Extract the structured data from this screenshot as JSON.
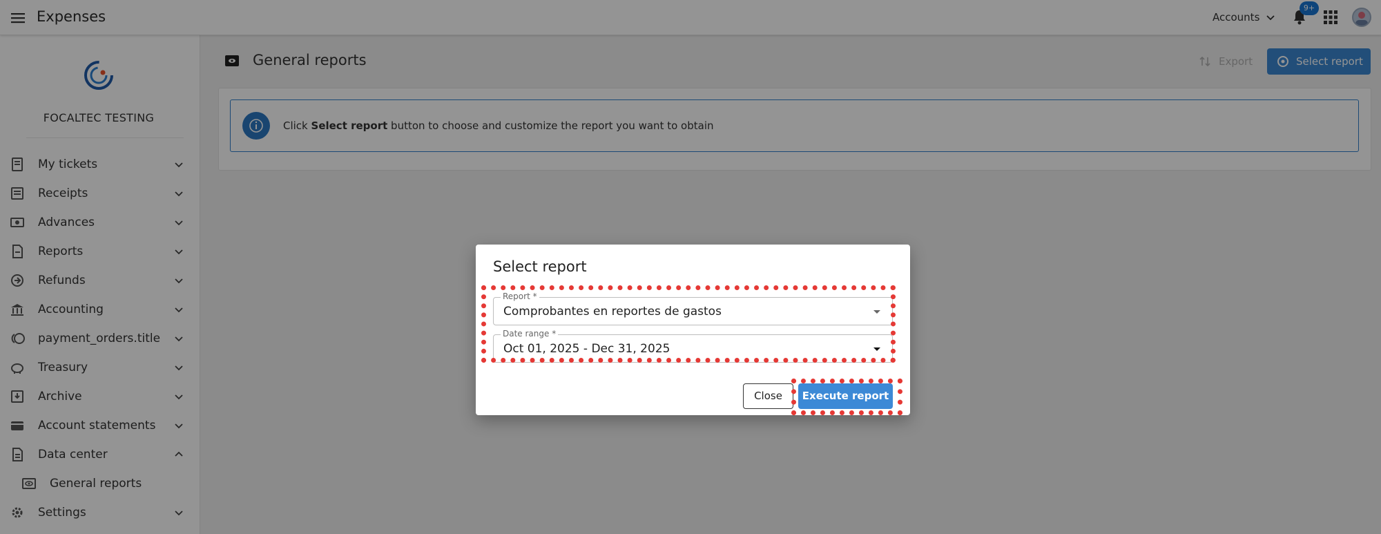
{
  "app": {
    "title": "Expenses",
    "accounts_label": "Accounts",
    "notification_badge": "9+"
  },
  "org_name": "FOCALTEC TESTING",
  "sidebar": {
    "items": [
      {
        "label": "My tickets",
        "icon": "ticket-icon",
        "expanded": false
      },
      {
        "label": "Receipts",
        "icon": "receipt-icon",
        "expanded": false
      },
      {
        "label": "Advances",
        "icon": "cash-icon",
        "expanded": false
      },
      {
        "label": "Reports",
        "icon": "report-icon",
        "expanded": false
      },
      {
        "label": "Refunds",
        "icon": "refund-icon",
        "expanded": false
      },
      {
        "label": "Accounting",
        "icon": "bank-icon",
        "expanded": false
      },
      {
        "label": "payment_orders.title",
        "icon": "coins-icon",
        "expanded": false
      },
      {
        "label": "Treasury",
        "icon": "piggy-bank-icon",
        "expanded": false
      },
      {
        "label": "Archive",
        "icon": "archive-icon",
        "expanded": false
      },
      {
        "label": "Account statements",
        "icon": "card-icon",
        "expanded": false
      },
      {
        "label": "Data center",
        "icon": "data-icon",
        "expanded": true
      },
      {
        "label": "General reports",
        "icon": "eye-report-icon",
        "sub": true
      },
      {
        "label": "Settings",
        "icon": "gear-icon",
        "expanded": false
      }
    ]
  },
  "main": {
    "title": "General reports",
    "export_label": "Export",
    "select_report_label": "Select report",
    "info": {
      "prefix": "Click ",
      "bold": "Select report",
      "suffix": " button to choose and customize the report you want to obtain"
    }
  },
  "dialog": {
    "title": "Select report",
    "report_label": "Report *",
    "report_value": "Comprobantes en reportes de gastos",
    "date_label": "Date range *",
    "date_value": "Oct 01, 2025 - Dec 31, 2025",
    "close_label": "Close",
    "execute_label": "Execute report"
  },
  "colors": {
    "primary": "#3b87d0",
    "highlight": "#e53935",
    "overlay": "rgba(0,0,0,0.42)"
  }
}
